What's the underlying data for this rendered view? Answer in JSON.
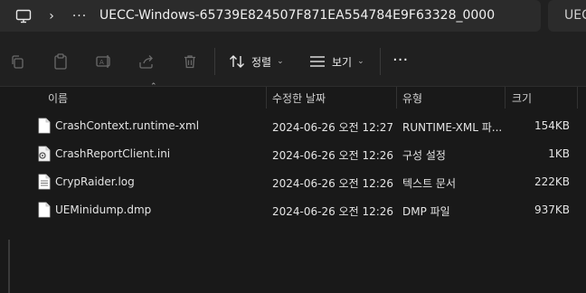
{
  "address_bar": {
    "path": "UECC-Windows-65739E824507F871EA554784E9F63328_0000",
    "chevron": "›",
    "ellipsis": "···",
    "search_partial": "UEC"
  },
  "toolbar": {
    "copy_icon": "copy-icon",
    "paste_icon": "paste-icon",
    "rename_icon": "rename-icon",
    "share_icon": "share-icon",
    "delete_icon": "trash-icon",
    "sort_label": "정렬",
    "view_label": "보기",
    "more_label": "···"
  },
  "columns": {
    "name": "이름",
    "date": "수정한 날짜",
    "type": "유형",
    "size": "크기"
  },
  "files": [
    {
      "name": "CrashContext.runtime-xml",
      "date": "2024-06-26 오전 12:27",
      "type": "RUNTIME-XML 파...",
      "size": "154KB",
      "icon": "document-icon"
    },
    {
      "name": "CrashReportClient.ini",
      "date": "2024-06-26 오전 12:26",
      "type": "구성 설정",
      "size": "1KB",
      "icon": "settings-file-icon"
    },
    {
      "name": "CrypRaider.log",
      "date": "2024-06-26 오전 12:26",
      "type": "텍스트 문서",
      "size": "222KB",
      "icon": "text-file-icon"
    },
    {
      "name": "UEMinidump.dmp",
      "date": "2024-06-26 오전 12:26",
      "type": "DMP 파일",
      "size": "937KB",
      "icon": "document-icon"
    }
  ],
  "colors": {
    "background": "#191919",
    "chrome": "#202020",
    "addr_box": "#2b2b2b",
    "text": "#e4e4e4"
  }
}
